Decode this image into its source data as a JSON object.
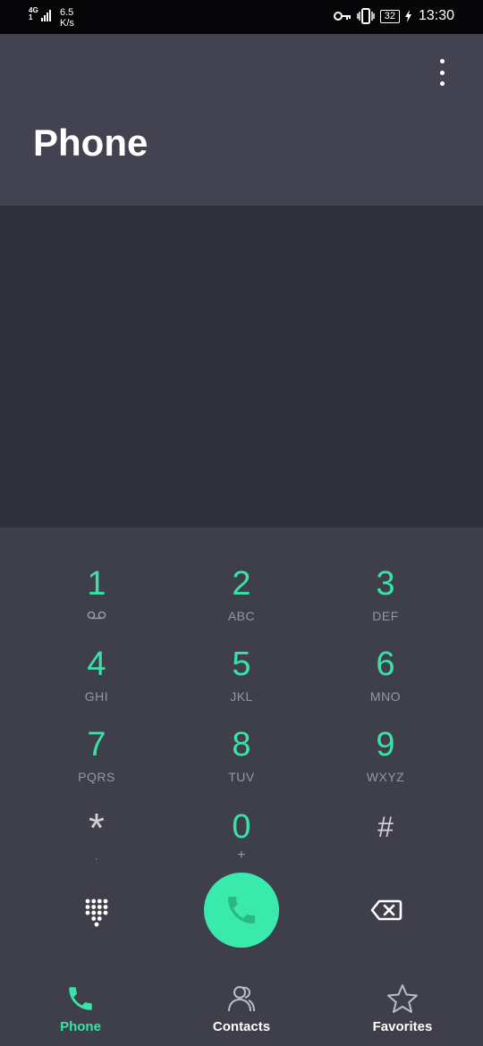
{
  "status_bar": {
    "network_type": "4G",
    "network_sub": "1",
    "speed_value": "6.5",
    "speed_unit": "K/s",
    "battery": "32",
    "time": "13:30"
  },
  "header": {
    "title": "Phone",
    "menu_icon": "more-vertical-icon"
  },
  "keypad": {
    "keys": [
      {
        "digit": "1",
        "letters": ""
      },
      {
        "digit": "2",
        "letters": "ABC"
      },
      {
        "digit": "3",
        "letters": "DEF"
      },
      {
        "digit": "4",
        "letters": "GHI"
      },
      {
        "digit": "5",
        "letters": "JKL"
      },
      {
        "digit": "6",
        "letters": "MNO"
      },
      {
        "digit": "7",
        "letters": "PQRS"
      },
      {
        "digit": "8",
        "letters": "TUV"
      },
      {
        "digit": "9",
        "letters": "WXYZ"
      },
      {
        "digit": "*",
        "letters": ","
      },
      {
        "digit": "0",
        "letters": "+"
      },
      {
        "digit": "#",
        "letters": ""
      }
    ],
    "accent_color": "#3ae2a7",
    "call_button_color": "#3ae9ac"
  },
  "bottom_nav": {
    "items": [
      {
        "label": "Phone",
        "icon": "phone-icon",
        "active": true
      },
      {
        "label": "Contacts",
        "icon": "contacts-icon",
        "active": false
      },
      {
        "label": "Favorites",
        "icon": "star-icon",
        "active": false
      }
    ]
  }
}
